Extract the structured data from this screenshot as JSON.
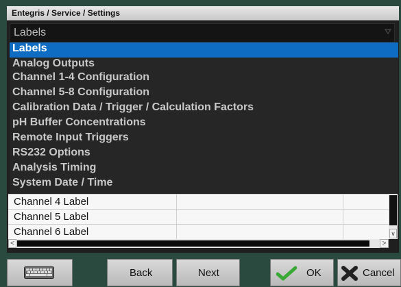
{
  "window": {
    "title": "Entegris / Service / Settings"
  },
  "combo": {
    "value": "Labels",
    "icon": "chevron-down-icon"
  },
  "dropdown": {
    "items": [
      {
        "label": "Labels",
        "selected": true
      },
      {
        "label": "Analog Outputs"
      },
      {
        "label": "Channel 1-4 Configuration"
      },
      {
        "label": "Channel 5-8 Configuration"
      },
      {
        "label": "Calibration Data / Trigger / Calculation Factors"
      },
      {
        "label": "pH Buffer Concentrations"
      },
      {
        "label": "Remote Input Triggers"
      },
      {
        "label": "RS232 Options"
      },
      {
        "label": "Analysis Timing"
      },
      {
        "label": "System Date / Time"
      }
    ]
  },
  "table": {
    "rows": [
      {
        "label": "Channel 4 Label",
        "value": "",
        "extra": ""
      },
      {
        "label": "Channel 5 Label",
        "value": "",
        "extra": ""
      },
      {
        "label": "Channel 6 Label",
        "value": "",
        "extra": ""
      }
    ]
  },
  "buttons": {
    "keyboard_icon": "keyboard-icon",
    "back": "Back",
    "next": "Next",
    "ok": "OK",
    "ok_icon": "checkmark-icon",
    "cancel": "Cancel",
    "cancel_icon": "x-icon"
  },
  "colors": {
    "selection": "#0e6cc2",
    "frame": "#2a4a40",
    "ok_check": "#39a935"
  }
}
